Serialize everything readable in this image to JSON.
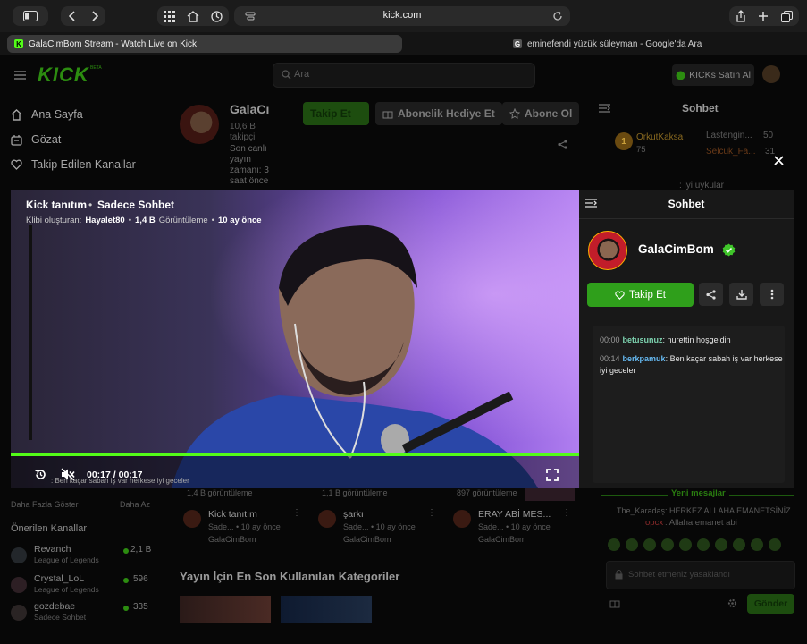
{
  "browser": {
    "url": "kick.com",
    "tabs": [
      {
        "label": "GalaCimBom Stream - Watch Live on Kick",
        "favicon": "K",
        "active": true
      },
      {
        "label": "eminefendi yüzük süleyman - Google'da Ara",
        "favicon": "G",
        "active": false
      }
    ]
  },
  "header": {
    "logo": "KICK",
    "logo_sup": "BETA",
    "search_placeholder": "Ara",
    "buy_kicks": "KICKs Satın Al"
  },
  "sidebar": {
    "nav": [
      {
        "label": "Ana Sayfa",
        "icon": "home-icon"
      },
      {
        "label": "Gözat",
        "icon": "browse-icon"
      },
      {
        "label": "Takip Edilen Kanallar",
        "icon": "heart-icon"
      }
    ],
    "show_more": "Daha Fazla Göster",
    "show_less": "Daha Az",
    "recommended_title": "Önerilen Kanallar",
    "recommended": [
      {
        "name": "Revanch",
        "category": "League of Legends",
        "viewers": "2,1 B"
      },
      {
        "name": "Crystal_LoL",
        "category": "League of Legends",
        "viewers": "596"
      },
      {
        "name": "gozdebae",
        "category": "Sadece Sohbet",
        "viewers": "335"
      }
    ]
  },
  "channel": {
    "name_truncated": "GalaCı",
    "followers_count": "10,6 B",
    "followers_label": "takipçi",
    "last_live": "Son canlı yayın zamanı: 3 saat önce",
    "follow_short": "Takip Et",
    "gift_sub": "Abonelik Hediye Et",
    "subscribe_short": "Abone Ol"
  },
  "clips": [
    {
      "views": "1,4 B görüntüleme",
      "title": "Kick tanıtım",
      "meta": "Sade... • 10 ay önce",
      "channel": "GalaCimBom"
    },
    {
      "views": "1,1 B görüntüleme",
      "title": "şarkı",
      "meta": "Sade... • 10 ay önce",
      "channel": "GalaCimBom"
    },
    {
      "views": "897 görüntüleme",
      "title": "ERAY ABİ MES...",
      "meta": "Sade... • 10 ay önce",
      "channel": "GalaCimBom"
    }
  ],
  "categories_title": "Yayın İçin En Son Kullanılan Kategoriler",
  "bg_chat": {
    "title": "Sohbet",
    "top_users": [
      {
        "rank": "1",
        "name": "OrkutKaksa",
        "value": "75"
      },
      {
        "name": "Lastengin...",
        "value": "50"
      },
      {
        "name": "Selcuk_Fa...",
        "value": "31"
      }
    ],
    "partial_msg": ": iyi uykular",
    "new_messages": "Yeni mesajlar",
    "msg1": "The_Karadaş: HERKEZ ALLAHA EMANETSİNİZ...",
    "msg2_user": "opcx",
    "msg2_text": ": Allaha emanet abi",
    "input_placeholder": "Sohbet etmeniz yasaklandı",
    "send": "Gönder"
  },
  "player": {
    "title": "Kick tanıtım",
    "category": "Sadece Sohbet",
    "creator_label": "Klibi oluşturan:",
    "creator": "Hayalet80",
    "views": "1,4 B",
    "views_label": "Görüntüleme",
    "ago": "10 ay önce",
    "time": "00:17 / 00:17",
    "progress": 1.0,
    "subtitle_ticker": ": Ben kaçar sabah iş var herkese iyi geceler"
  },
  "clip_chat": {
    "title": "Sohbet",
    "streamer": "GalaCimBom",
    "follow": "Takip Et",
    "messages": [
      {
        "time": "00:00",
        "user": "betusunuz",
        "user_color": "#7dd3b0",
        "text": ": nurettin hoşgeldin"
      },
      {
        "time": "00:14",
        "user": "berkpamuk",
        "user_color": "#65b8f0",
        "text": ": Ben kaçar sabah iş var herkese iyi geceler"
      }
    ]
  },
  "colors": {
    "kick_green": "#53fc18",
    "follow_btn": "#2f9f1b",
    "verified": "#3fc52a"
  }
}
